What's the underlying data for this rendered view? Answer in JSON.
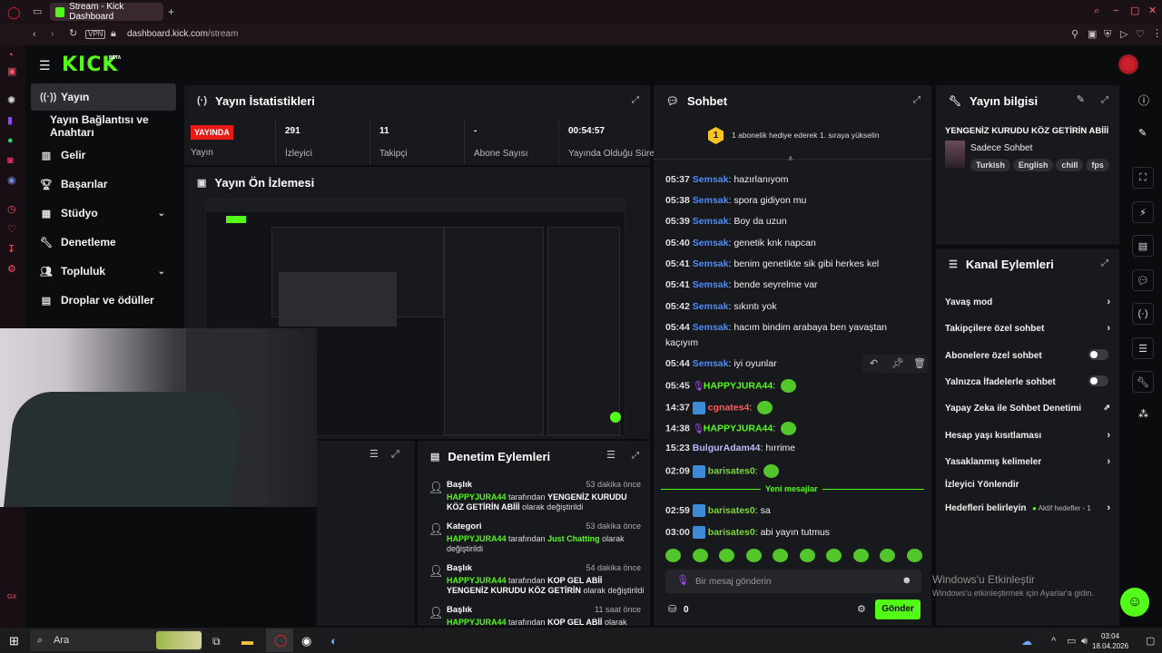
{
  "browser": {
    "tab_title": "Stream - Kick Dashboard",
    "url_domain": "dashboard.kick.com",
    "url_path": "/stream",
    "vpn_label": "VPN"
  },
  "brand": {
    "logo_text": "KICK",
    "beta_label": "BETA",
    "accent": "#53fc18"
  },
  "sidebar": {
    "items": [
      {
        "label": "Yayın",
        "icon": "broadcast-icon"
      },
      {
        "label": "Yayın Bağlantısı ve Anahtarı",
        "icon": ""
      },
      {
        "label": "Gelir",
        "icon": "chart-icon"
      },
      {
        "label": "Başarılar",
        "icon": "trophy-icon"
      },
      {
        "label": "Stüdyo",
        "icon": "grid-icon"
      },
      {
        "label": "Denetleme",
        "icon": "wrench-icon"
      },
      {
        "label": "Topluluk",
        "icon": "users-icon"
      },
      {
        "label": "Droplar ve ödüller",
        "icon": "gift-icon"
      }
    ]
  },
  "stats": {
    "title": "Yayın İstatistikleri",
    "live_badge": "YAYINDA",
    "cells": [
      {
        "value": "",
        "label": "Yayın"
      },
      {
        "value": "291",
        "label": "İzleyici"
      },
      {
        "value": "11",
        "label": "Takipçi"
      },
      {
        "value": "-",
        "label": "Abone Sayısı"
      },
      {
        "value": "00:54:57",
        "label": "Yayında Olduğu Süre"
      }
    ]
  },
  "preview": {
    "title": "Yayın Ön İzlemesi"
  },
  "moderation": {
    "title": "Denetim Eylemleri",
    "items": [
      {
        "type": "Başlık",
        "time": "53 dakika önce",
        "user": "HAPPYJURA44",
        "mid": " tarafından ",
        "value": "YENGENİZ KURUDU KÖZ GETİRİN ABİİİ",
        "tail": " olarak değiştirildi"
      },
      {
        "type": "Kategori",
        "time": "53 dakika önce",
        "user": "HAPPYJURA44",
        "mid": " tarafından ",
        "value": "Just Chatting",
        "tail": " olarak değiştirildi"
      },
      {
        "type": "Başlık",
        "time": "54 dakika önce",
        "user": "HAPPYJURA44",
        "mid": " tarafından ",
        "value": "KOP GEL ABİİ YENGENİZ KURUDU KÖZ GETİRİN",
        "tail": " olarak değiştirildi"
      },
      {
        "type": "Başlık",
        "time": "11 saat önce",
        "user": "HAPPYJURA44",
        "mid": " tarafından ",
        "value": "KOP GEL ABİİ",
        "tail": " olarak"
      }
    ]
  },
  "chat": {
    "title": "Sohbet",
    "gift_notice": "1 abonelik hediye ederek 1. sıraya yükselin",
    "gift_rank": "1",
    "messages": [
      {
        "time": "05:37",
        "user": "Semsak",
        "color": "#4f8cf7",
        "text": "hazırlanıyom"
      },
      {
        "time": "05:38",
        "user": "Semsak",
        "color": "#4f8cf7",
        "text": "spora gidiyon mu"
      },
      {
        "time": "05:39",
        "user": "Semsak",
        "color": "#4f8cf7",
        "text": "Boy da uzun"
      },
      {
        "time": "05:40",
        "user": "Semsak",
        "color": "#4f8cf7",
        "text": "genetik knk napcan"
      },
      {
        "time": "05:41",
        "user": "Semsak",
        "color": "#4f8cf7",
        "text": "benim genetikte sik gibi herkes kel"
      },
      {
        "time": "05:41",
        "user": "Semsak",
        "color": "#4f8cf7",
        "text": "bende seyrelme var"
      },
      {
        "time": "05:42",
        "user": "Semsak",
        "color": "#4f8cf7",
        "text": "sıkıntı yok"
      },
      {
        "time": "05:44",
        "user": "Semsak",
        "color": "#4f8cf7",
        "text": "hacım bindim arabaya ben yavaştan"
      },
      {
        "time": "",
        "user": "",
        "color": "#4f8cf7",
        "text": "kaçıyım"
      },
      {
        "time": "05:44",
        "user": "Semsak",
        "color": "#4f8cf7",
        "text": "iyi oyunlar"
      },
      {
        "time": "05:45",
        "user": "HAPPYJURA44",
        "color": "#53fc18",
        "text": ""
      },
      {
        "time": "14:37",
        "user": "cgnates4",
        "color": "#ff5b5b",
        "text": ""
      },
      {
        "time": "14:38",
        "user": "HAPPYJURA44",
        "color": "#53fc18",
        "text": ""
      },
      {
        "time": "15:23",
        "user": "BulgurAdam44",
        "color": "#b9b9ff",
        "text": "hırrime"
      },
      {
        "time": "02:09",
        "user": "barisates0",
        "color": "#7cd63a",
        "text": ""
      }
    ],
    "new_messages_label": "Yeni mesajlar",
    "new_messages": [
      {
        "time": "02:59",
        "user": "barisates0",
        "color": "#7cd63a",
        "text": "sa"
      },
      {
        "time": "03:00",
        "user": "barisates0",
        "color": "#7cd63a",
        "text": "abi yayın tutmus"
      }
    ],
    "input_placeholder": "Bir mesaj gönderin",
    "points": "0",
    "send_label": "Gönder"
  },
  "stream_info": {
    "title": "Yayın bilgisi",
    "stream_title": "YENGENİZ KURUDU KÖZ GETİRİN ABİİİ",
    "category": "Sadece Sohbet",
    "tags": [
      "Turkish",
      "English",
      "chill",
      "fps"
    ]
  },
  "channel_actions": {
    "title": "Kanal Eylemleri",
    "items": [
      {
        "label": "Yavaş mod",
        "control": "chevron"
      },
      {
        "label": "Takipçilere özel sohbet",
        "control": "chevron"
      },
      {
        "label": "Abonelere özel sohbet",
        "control": "toggle"
      },
      {
        "label": "Yalnızca İfadelerle sohbet",
        "control": "toggle"
      },
      {
        "label": "Yapay Zeka ile Sohbet Denetimi",
        "control": "external"
      },
      {
        "label": "Hesap yaşı kısıtlaması",
        "control": "chevron"
      },
      {
        "label": "Yasaklanmış kelimeler",
        "control": "chevron"
      },
      {
        "label": "İzleyici Yönlendir",
        "control": "none"
      },
      {
        "label": "Hedefleri belirleyin",
        "control": "chevron"
      }
    ],
    "goals_status": "Aktif hedefler - 1"
  },
  "windows": {
    "activate_title": "Windows'u Etkinleştir",
    "activate_sub": "Windows'u etkinleştirmek için Ayarlar'a gidin.",
    "search_label": "Ara",
    "clock_time": "03:04",
    "clock_date": "18.04.2026"
  }
}
